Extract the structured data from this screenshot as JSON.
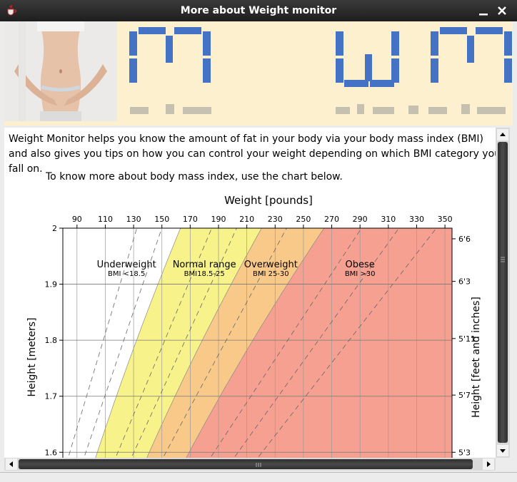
{
  "window": {
    "title": "More about Weight monitor"
  },
  "banner": {
    "logo_text": "WM",
    "digit_color": "#4472c4",
    "photo_name": "waist-measuring-tape-photo"
  },
  "content": {
    "intro": "Weight Monitor helps you know the amount of fat in your body via your body mass index (BMI) and also gives you tips on how you can control your weight depending on which BMI category you fall on.",
    "chart_intro": "To know more about body mass index, use the chart below."
  },
  "chart_data": {
    "type": "area",
    "title": "Weight [pounds]",
    "ylabel": "Height [meters]",
    "ylabel_right": "Height [feet and inches]",
    "x_ticks_top": [
      "90",
      "110",
      "130",
      "150",
      "170",
      "190",
      "210",
      "230",
      "250",
      "270",
      "290",
      "310",
      "330",
      "350"
    ],
    "x_tick_values": [
      90,
      110,
      130,
      150,
      170,
      190,
      210,
      230,
      250,
      270,
      290,
      310,
      330,
      350
    ],
    "xlim": [
      80,
      355
    ],
    "ylim": [
      1.58,
      2.0
    ],
    "y_ticks_left": [
      {
        "value": 2.0,
        "label": "2"
      },
      {
        "value": 1.9,
        "label": "1.9"
      },
      {
        "value": 1.8,
        "label": "1.8"
      },
      {
        "value": 1.7,
        "label": "1.7"
      },
      {
        "value": 1.6,
        "label": "1.6"
      }
    ],
    "y_ticks_right": [
      {
        "value": 1.981,
        "label": "6'6"
      },
      {
        "value": 1.905,
        "label": "6'3"
      },
      {
        "value": 1.803,
        "label": "5'11"
      },
      {
        "value": 1.702,
        "label": "5'7"
      },
      {
        "value": 1.6,
        "label": "5'3"
      }
    ],
    "bmi_boundaries": [
      18.5,
      25,
      30
    ],
    "dashed_bmi_lines": [
      15,
      17,
      21,
      23,
      27,
      33,
      36,
      39
    ],
    "categories": [
      {
        "name": "Underweight",
        "range": "BMI <18.5",
        "color": "#ffffff",
        "label_lb": 125,
        "label_m": 1.93
      },
      {
        "name": "Normal range",
        "range": "BMI18.5-25",
        "color": "#f7f28a",
        "label_lb": 180,
        "label_m": 1.93
      },
      {
        "name": "Overweight",
        "range": "BMI 25-30",
        "color": "#f9c98a",
        "label_lb": 227,
        "label_m": 1.93
      },
      {
        "name": "Obese",
        "range": "BMI >30",
        "color": "#f5a090",
        "label_lb": 290,
        "label_m": 1.93
      }
    ],
    "grid": true
  }
}
